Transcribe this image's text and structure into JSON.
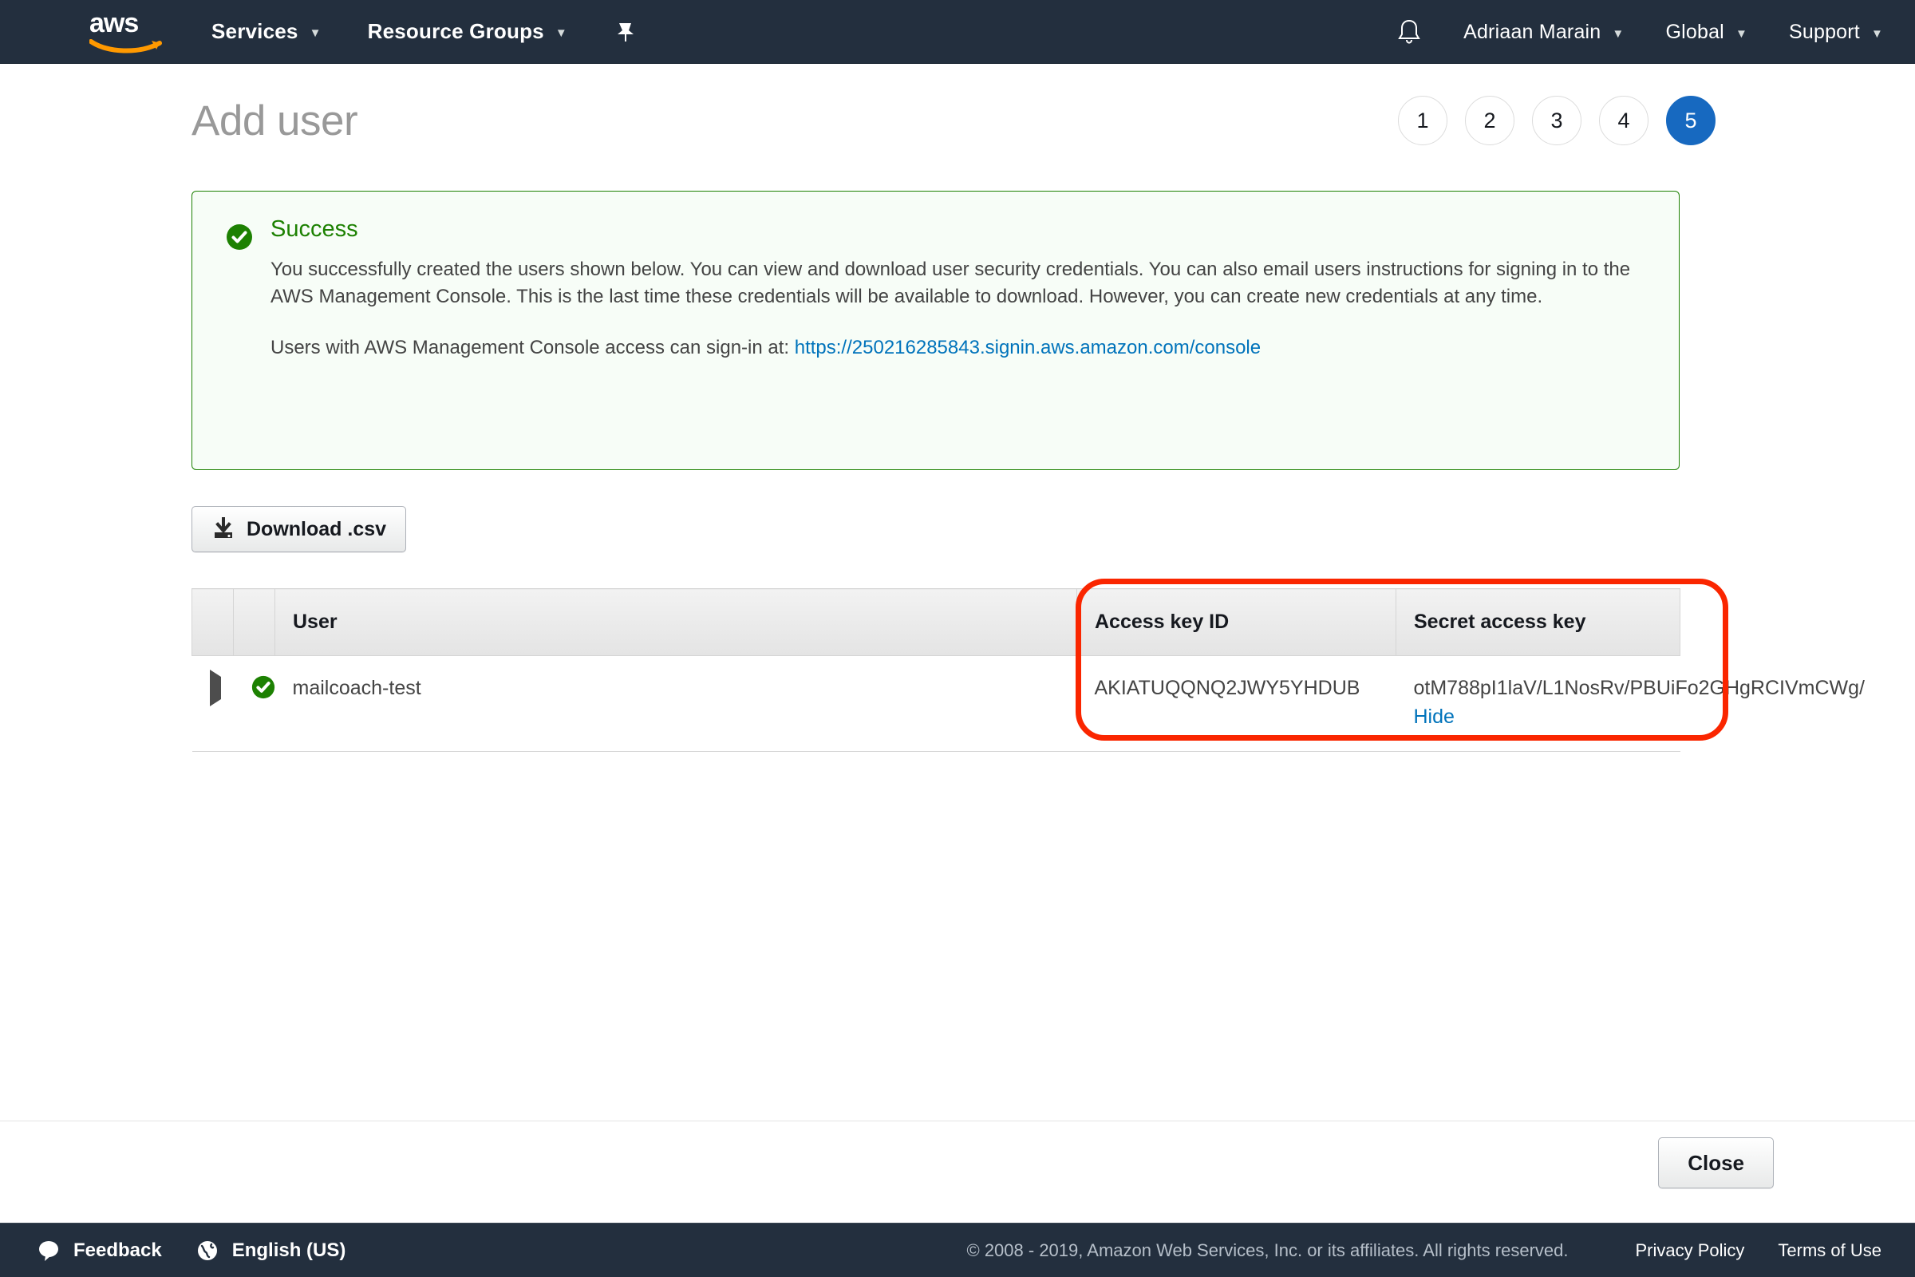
{
  "topnav": {
    "logo_alt": "aws",
    "services_label": "Services",
    "resource_groups_label": "Resource Groups",
    "pin_icon": "pin-icon",
    "bell_icon": "bell-icon",
    "account_label": "Adriaan Marain",
    "region_label": "Global",
    "support_label": "Support",
    "caret": "▼"
  },
  "header": {
    "title": "Add user",
    "steps": [
      {
        "label": "1",
        "active": false
      },
      {
        "label": "2",
        "active": false
      },
      {
        "label": "3",
        "active": false
      },
      {
        "label": "4",
        "active": false
      },
      {
        "label": "5",
        "active": true
      }
    ],
    "active_step_color": "#1769c0"
  },
  "alert": {
    "icon": "success-check-icon",
    "status_color": "#1d8102",
    "title": "Success",
    "paragraph1": "You successfully created the users shown below. You can view and download user security credentials. You can also email users instructions for signing in to the AWS Management Console. This is the last time these credentials will be available to download. However, you can create new credentials at any time.",
    "paragraph2_prefix": "Users with AWS Management Console access can sign-in at: ",
    "signin_url": "https://250216285843.signin.aws.amazon.com/console",
    "link_color": "#0073bb"
  },
  "toolbar": {
    "download_label": "Download .csv",
    "download_icon": "download-icon"
  },
  "table": {
    "columns": [
      "",
      "",
      "User",
      "Access key ID",
      "Secret access key"
    ],
    "rows": [
      {
        "caret_icon": "expand-caret-icon",
        "status_icon": "success-check-icon",
        "user": "mailcoach-test",
        "access_key_id": "AKIATUQQNQ2JWY5YHDUB",
        "secret_access_key": "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",
        "hide_label": "Hide"
      }
    ],
    "annotation_color": "#fa2600"
  },
  "actions": {
    "close_label": "Close"
  },
  "bottombar": {
    "feedback_label": "Feedback",
    "feedback_icon": "speech-bubble-icon",
    "language_label": "English (US)",
    "language_icon": "globe-icon",
    "copyright": "© 2008 - 2019, Amazon Web Services, Inc. or its affiliates. All rights reserved.",
    "privacy_label": "Privacy Policy",
    "terms_label": "Terms of Use"
  }
}
